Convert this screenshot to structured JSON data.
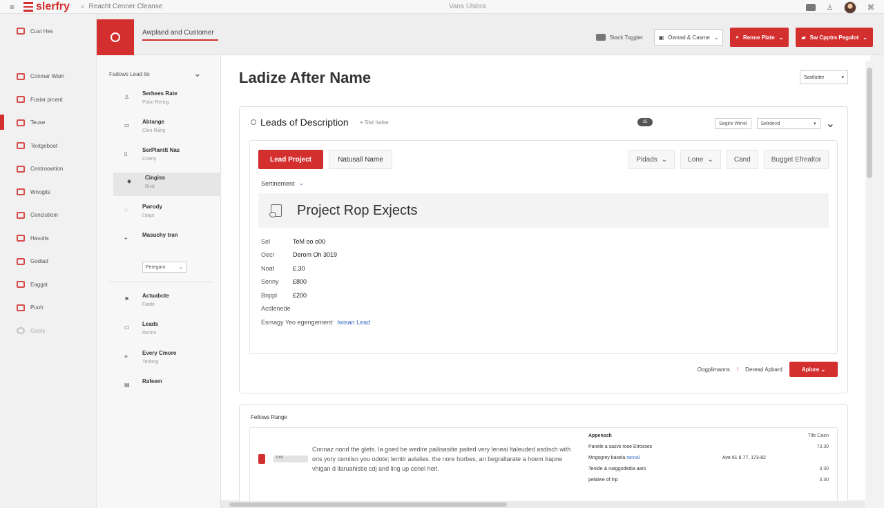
{
  "topbar": {
    "brand": "slerfry",
    "search_text": "Reacht Cenner Cleanse",
    "center_title": "Vans Ulsbra"
  },
  "leftnav": {
    "top_label": "Cust Hes",
    "items": [
      {
        "label": "Conmar Wam",
        "icon": "customer-icon"
      },
      {
        "label": "Fusiar prcent",
        "icon": "product-icon"
      },
      {
        "label": "Teuse",
        "icon": "team-icon",
        "active": true
      },
      {
        "label": "Textgeboot",
        "icon": "document-icon"
      },
      {
        "label": "Centroowtion",
        "icon": "user-icon"
      },
      {
        "label": "Wnogits",
        "icon": "mail-icon"
      },
      {
        "label": "Cenclutiom",
        "icon": "folder-icon"
      },
      {
        "label": "Havolts",
        "icon": "chat-icon"
      },
      {
        "label": "Godiad",
        "icon": "globe-icon"
      },
      {
        "label": "Eaggst",
        "icon": "calendar-icon"
      },
      {
        "label": "Puoh",
        "icon": "card-icon"
      },
      {
        "label": "Goots",
        "icon": "circle-icon",
        "disabled": true
      }
    ]
  },
  "header": {
    "title": "Awplaed and Customer",
    "link": "Stack Toggler",
    "dropdown": "Ownad & Casme",
    "primary_button": "Renne Plate",
    "secondary_button": "Sw Cpptrs Pegalot"
  },
  "subnav": {
    "title": "Fadows Lead ito",
    "items": [
      {
        "label": "Serhees Rate",
        "sub": "Pobe Rering",
        "icon": "user-icon"
      },
      {
        "label": "Abtange",
        "sub": "Clon Rang",
        "icon": "box-icon"
      },
      {
        "label": "SerPlantlt Nas",
        "sub": "Coeny",
        "icon": "page-icon"
      },
      {
        "label": "Cingiss",
        "sub": "Bisd",
        "icon": "shield-icon",
        "active": true
      },
      {
        "label": "Pwrody",
        "sub": "Ltage",
        "icon": "settings-icon"
      },
      {
        "label": "Masuchy tran",
        "sub": "",
        "icon": "pin-icon"
      },
      {
        "label": "Actuabcte",
        "sub": "Fatde",
        "icon": "flag-icon"
      },
      {
        "label": "Leads",
        "sub": "Rsmm",
        "icon": "list-icon"
      },
      {
        "label": "Every Cmore",
        "sub": "Terlong",
        "icon": "bars-icon"
      },
      {
        "label": "Rafeem",
        "sub": "",
        "icon": "table-icon"
      }
    ],
    "select": "Peregam"
  },
  "main": {
    "page_title": "Ladize After Name",
    "top_dropdown": "Sastlutter"
  },
  "card": {
    "title": "Leads of Description",
    "sort": "Sist halse",
    "pill": "25",
    "input": "Segire Wirrel",
    "select": "Selrdevd",
    "lead_button": "Lead Project",
    "natural_button": "Natusall Name",
    "tools": [
      "Pidads",
      "Lone",
      "Cand",
      "Bugget Efrealtor"
    ],
    "sentiment": "Sertinement",
    "project_title": "Project Rop Exjects",
    "details": [
      {
        "label": "Sel",
        "value": "TeM oo o00"
      },
      {
        "label": "Oecr",
        "value": "Derom Oh 3019"
      },
      {
        "label": "Noat",
        "value": "£.30"
      },
      {
        "label": "Senny",
        "value": "£800"
      },
      {
        "label": "Bnppl",
        "value": "£200"
      },
      {
        "label": "Acdlenede",
        "value": ""
      }
    ],
    "engagement_label": "Esmagy Yeo egengement:",
    "engagement_link": "Iwisan Lead",
    "footer_label": "Oogplimanns",
    "footer_link": "Deread Apbard",
    "update_button": "Aplore"
  },
  "range": {
    "title": "Fellows Range",
    "chip": "tnot",
    "text": "Connaz nond the glets. Ia goed be wedire pailisasitie paited very leneai ltaleuded asdisch with ons yory cemiisn you odote; lemtir avlalies. the nore horbes, an begraltarate a hoem lrapne vhigan d llaruahistle cdj and ling up cenel heit.",
    "approach_head": "Appenssh",
    "approach_rows": [
      "Panele a sasvs rose Etrosses",
      "Mngsgrey basela",
      "Tenide & natggodedia aars",
      "pelalwe of lnp"
    ],
    "approach_link": "tannal",
    "amount": "Ave 61 6.77, 173-82",
    "time_head": "Tife Ceen",
    "time_values": [
      "73.30",
      "3.30",
      "3.30"
    ]
  }
}
